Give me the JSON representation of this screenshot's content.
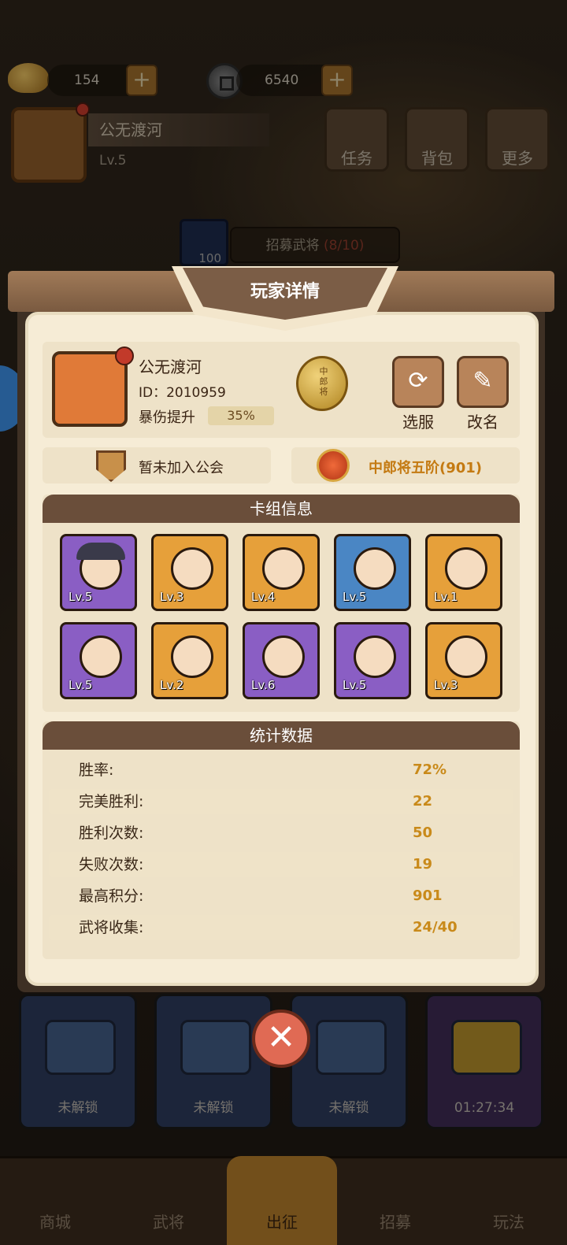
{
  "colors": {
    "accent": "#c98a1a",
    "panel": "#f6ecd6",
    "header": "#6a4e3a",
    "danger": "#e06a54"
  },
  "topbar": {
    "gold": "154",
    "coins": "6540"
  },
  "header": {
    "name": "公无渡河",
    "level": "Lv.5",
    "buttons": [
      "任务",
      "背包",
      "更多"
    ]
  },
  "recruit": {
    "label": "招募武将",
    "count": "(8/10)",
    "cost": "100"
  },
  "modal": {
    "title": "玩家详情",
    "player": {
      "name": "公无渡河",
      "id": "ID：2010959",
      "crit_label": "暴伤提升",
      "crit_value": "35%",
      "rank_badge": "中郎将"
    },
    "actions": {
      "switch_server": "选服",
      "rename": "改名"
    },
    "guild": "暂未加入公会",
    "rank": "中郎将五阶(901)",
    "deck": {
      "title": "卡组信息",
      "heroes": [
        {
          "level": "Lv.5",
          "rarity": "purple",
          "icon": "straw-hat-soldier-icon"
        },
        {
          "level": "Lv.3",
          "rarity": "orange",
          "icon": "old-sage-icon"
        },
        {
          "level": "Lv.4",
          "rarity": "orange",
          "icon": "armored-general-icon"
        },
        {
          "level": "Lv.5",
          "rarity": "blue",
          "icon": "red-bearded-warrior-icon"
        },
        {
          "level": "Lv.1",
          "rarity": "orange",
          "icon": "white-haired-general-icon"
        },
        {
          "level": "Lv.5",
          "rarity": "purple",
          "icon": "silver-armor-general-icon"
        },
        {
          "level": "Lv.2",
          "rarity": "orange",
          "icon": "swordsman-icon"
        },
        {
          "level": "Lv.6",
          "rarity": "purple",
          "icon": "blue-helmet-general-icon"
        },
        {
          "level": "Lv.5",
          "rarity": "purple",
          "icon": "bearded-fighter-icon"
        },
        {
          "level": "Lv.3",
          "rarity": "orange",
          "icon": "young-lord-icon"
        }
      ]
    },
    "stats": {
      "title": "统计数据",
      "rows": [
        {
          "label": "胜率:",
          "value": "72%"
        },
        {
          "label": "完美胜利:",
          "value": "22"
        },
        {
          "label": "胜利次数:",
          "value": "50"
        },
        {
          "label": "失败次数:",
          "value": "19"
        },
        {
          "label": "最高积分:",
          "value": "901"
        },
        {
          "label": "武将收集:",
          "value": "24/40"
        }
      ]
    }
  },
  "chests": [
    "未解锁",
    "未解锁",
    "未解锁",
    "01:27:34"
  ],
  "nav": [
    "商城",
    "武将",
    "出征",
    "招募",
    "玩法"
  ]
}
